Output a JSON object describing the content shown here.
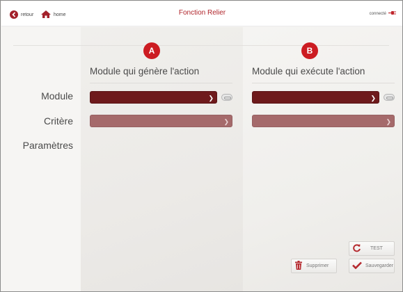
{
  "header": {
    "back_label": "retour",
    "home_label": "home",
    "title": "Fonction Relier",
    "status": "connecté"
  },
  "badges": {
    "a": "A",
    "b": "B"
  },
  "columns": {
    "a_heading": "Module qui génère l'action",
    "b_heading": "Module qui exécute l'action"
  },
  "rows": {
    "module": "Module",
    "critere": "Critère",
    "parametres": "Paramètres"
  },
  "buttons": {
    "test": "TEST",
    "supprimer": "Supprimer",
    "sauvegarder": "Sauvegarder"
  },
  "colors": {
    "brand": "#cc1c22",
    "select_active": "#6e1a1c",
    "select_disabled": "#a56a6b"
  },
  "icons": {
    "back": "back-arrow-icon",
    "home": "home-icon",
    "connected": "plug-icon",
    "test": "refresh-icon",
    "delete": "trash-icon",
    "save": "checkmark-icon",
    "link": "link-icon"
  }
}
